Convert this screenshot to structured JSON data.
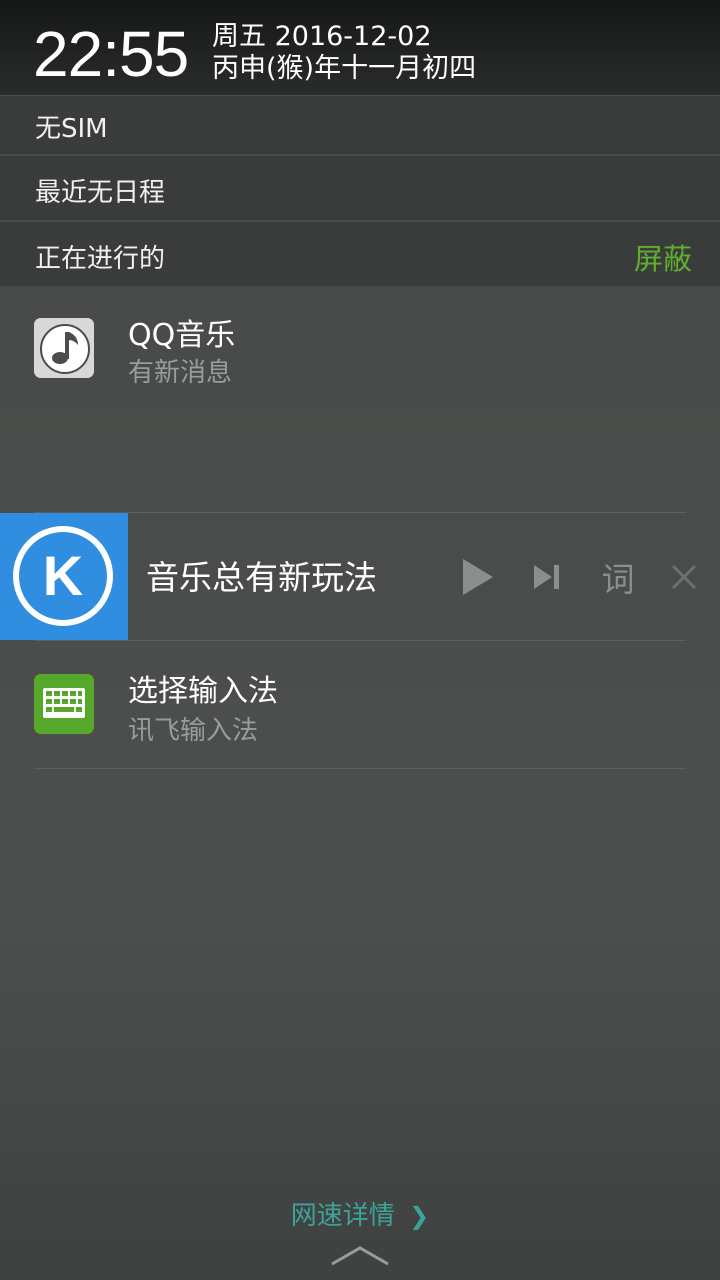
{
  "status": {
    "time": "22:55",
    "date_line": "周五 2016-12-02",
    "lunar_line": "丙申(猴)年十一月初四"
  },
  "sim_status": "无SIM",
  "calendar_status": "最近无日程",
  "ongoing": {
    "label": "正在进行的",
    "mask_label": "屏蔽"
  },
  "notifications": [
    {
      "app": "QQ音乐",
      "text": "有新消息",
      "icon": "qq-music-icon"
    },
    {
      "app": "选择输入法",
      "text": "讯飞输入法",
      "icon": "keyboard-icon"
    }
  ],
  "music_player": {
    "title": "音乐总有新玩法",
    "logo_letter": "K",
    "lyrics_label": "词",
    "icons": [
      "play-icon",
      "next-track-icon",
      "close-icon"
    ]
  },
  "footer": {
    "network_details_label": "网速详情",
    "chevron": "❯"
  },
  "colors": {
    "accent_green": "#5fae2e",
    "kugou_blue": "#2f8ee0",
    "link_teal": "#3aa39a",
    "keyboard_green": "#55a82a"
  }
}
